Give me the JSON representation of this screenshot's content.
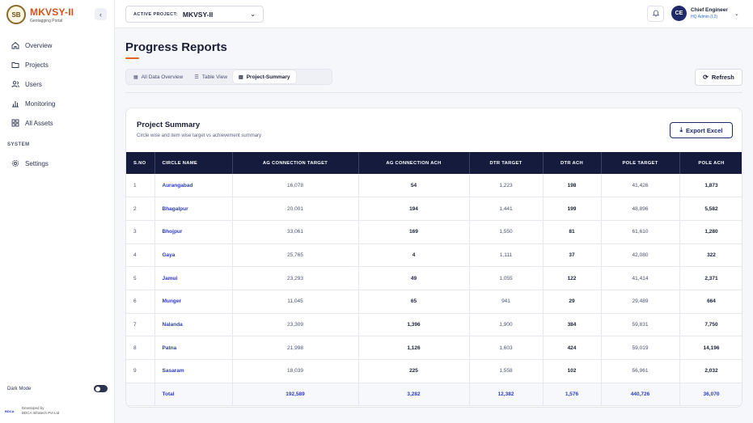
{
  "brand": {
    "logo_text": "SB",
    "title": "MKVSY-II",
    "subtitle": "Geotagging Portal"
  },
  "sidebar": {
    "items": [
      {
        "label": "Overview",
        "icon": "home-icon"
      },
      {
        "label": "Projects",
        "icon": "folder-icon"
      },
      {
        "label": "Users",
        "icon": "users-icon"
      },
      {
        "label": "Monitoring",
        "icon": "bar-chart-icon"
      },
      {
        "label": "All Assets",
        "icon": "grid-icon"
      }
    ],
    "system_label": "SYSTEM",
    "settings_label": "Settings",
    "dark_mode_label": "Dark Mode",
    "developer_logo": "BDCA",
    "developer_line1": "Developed by",
    "developer_line2": "BDCA Infratech Pvt Ltd"
  },
  "topbar": {
    "project_label": "ACTIVE PROJECT:",
    "project_value": "MKVSY-II",
    "user_initials": "CE",
    "user_name": "Chief Engineer",
    "user_role": "HQ Admin (L2)"
  },
  "page": {
    "title": "Progress Reports",
    "tabs": [
      {
        "label": "All Data Overview",
        "icon": "grid-icon",
        "active": false
      },
      {
        "label": "Table View",
        "icon": "list-icon",
        "active": false
      },
      {
        "label": "Project-Summary",
        "icon": "document-icon",
        "active": true
      }
    ],
    "refresh_label": "Refresh"
  },
  "summary": {
    "title": "Project Summary",
    "subtitle": "Circle wise and item wise target vs achievement summary",
    "export_label": "Export Excel",
    "columns": [
      "S.NO",
      "CIRCLE NAME",
      "AG CONNECTION TARGET",
      "AG CONNECTION ACH",
      "DTR TARGET",
      "DTR ACH",
      "POLE TARGET",
      "POLE ACH"
    ],
    "rows": [
      [
        "1",
        "Aurangabad",
        "16,078",
        "54",
        "1,223",
        "198",
        "41,426",
        "1,873"
      ],
      [
        "2",
        "Bhagalpur",
        "20,001",
        "194",
        "1,441",
        "199",
        "48,896",
        "5,582"
      ],
      [
        "3",
        "Bhojpur",
        "33,061",
        "169",
        "1,550",
        "81",
        "61,610",
        "1,280"
      ],
      [
        "4",
        "Gaya",
        "25,765",
        "4",
        "1,111",
        "37",
        "42,080",
        "322"
      ],
      [
        "5",
        "Jamui",
        "23,293",
        "49",
        "1,055",
        "122",
        "41,414",
        "2,371"
      ],
      [
        "6",
        "Munger",
        "11,045",
        "65",
        "941",
        "29",
        "29,489",
        "664"
      ],
      [
        "7",
        "Nalanda",
        "23,309",
        "1,396",
        "1,900",
        "384",
        "59,831",
        "7,750"
      ],
      [
        "8",
        "Patna",
        "21,998",
        "1,126",
        "1,603",
        "424",
        "59,019",
        "14,196"
      ],
      [
        "9",
        "Sasaram",
        "18,039",
        "225",
        "1,558",
        "102",
        "56,961",
        "2,032"
      ]
    ],
    "total": [
      "",
      "Total",
      "192,589",
      "3,282",
      "12,382",
      "1,576",
      "440,726",
      "36,070"
    ]
  },
  "colors": {
    "accent": "#e2642b",
    "header_bg": "#141b3d",
    "link": "#2b3bbf",
    "avatar_bg": "#1f2a6b"
  }
}
